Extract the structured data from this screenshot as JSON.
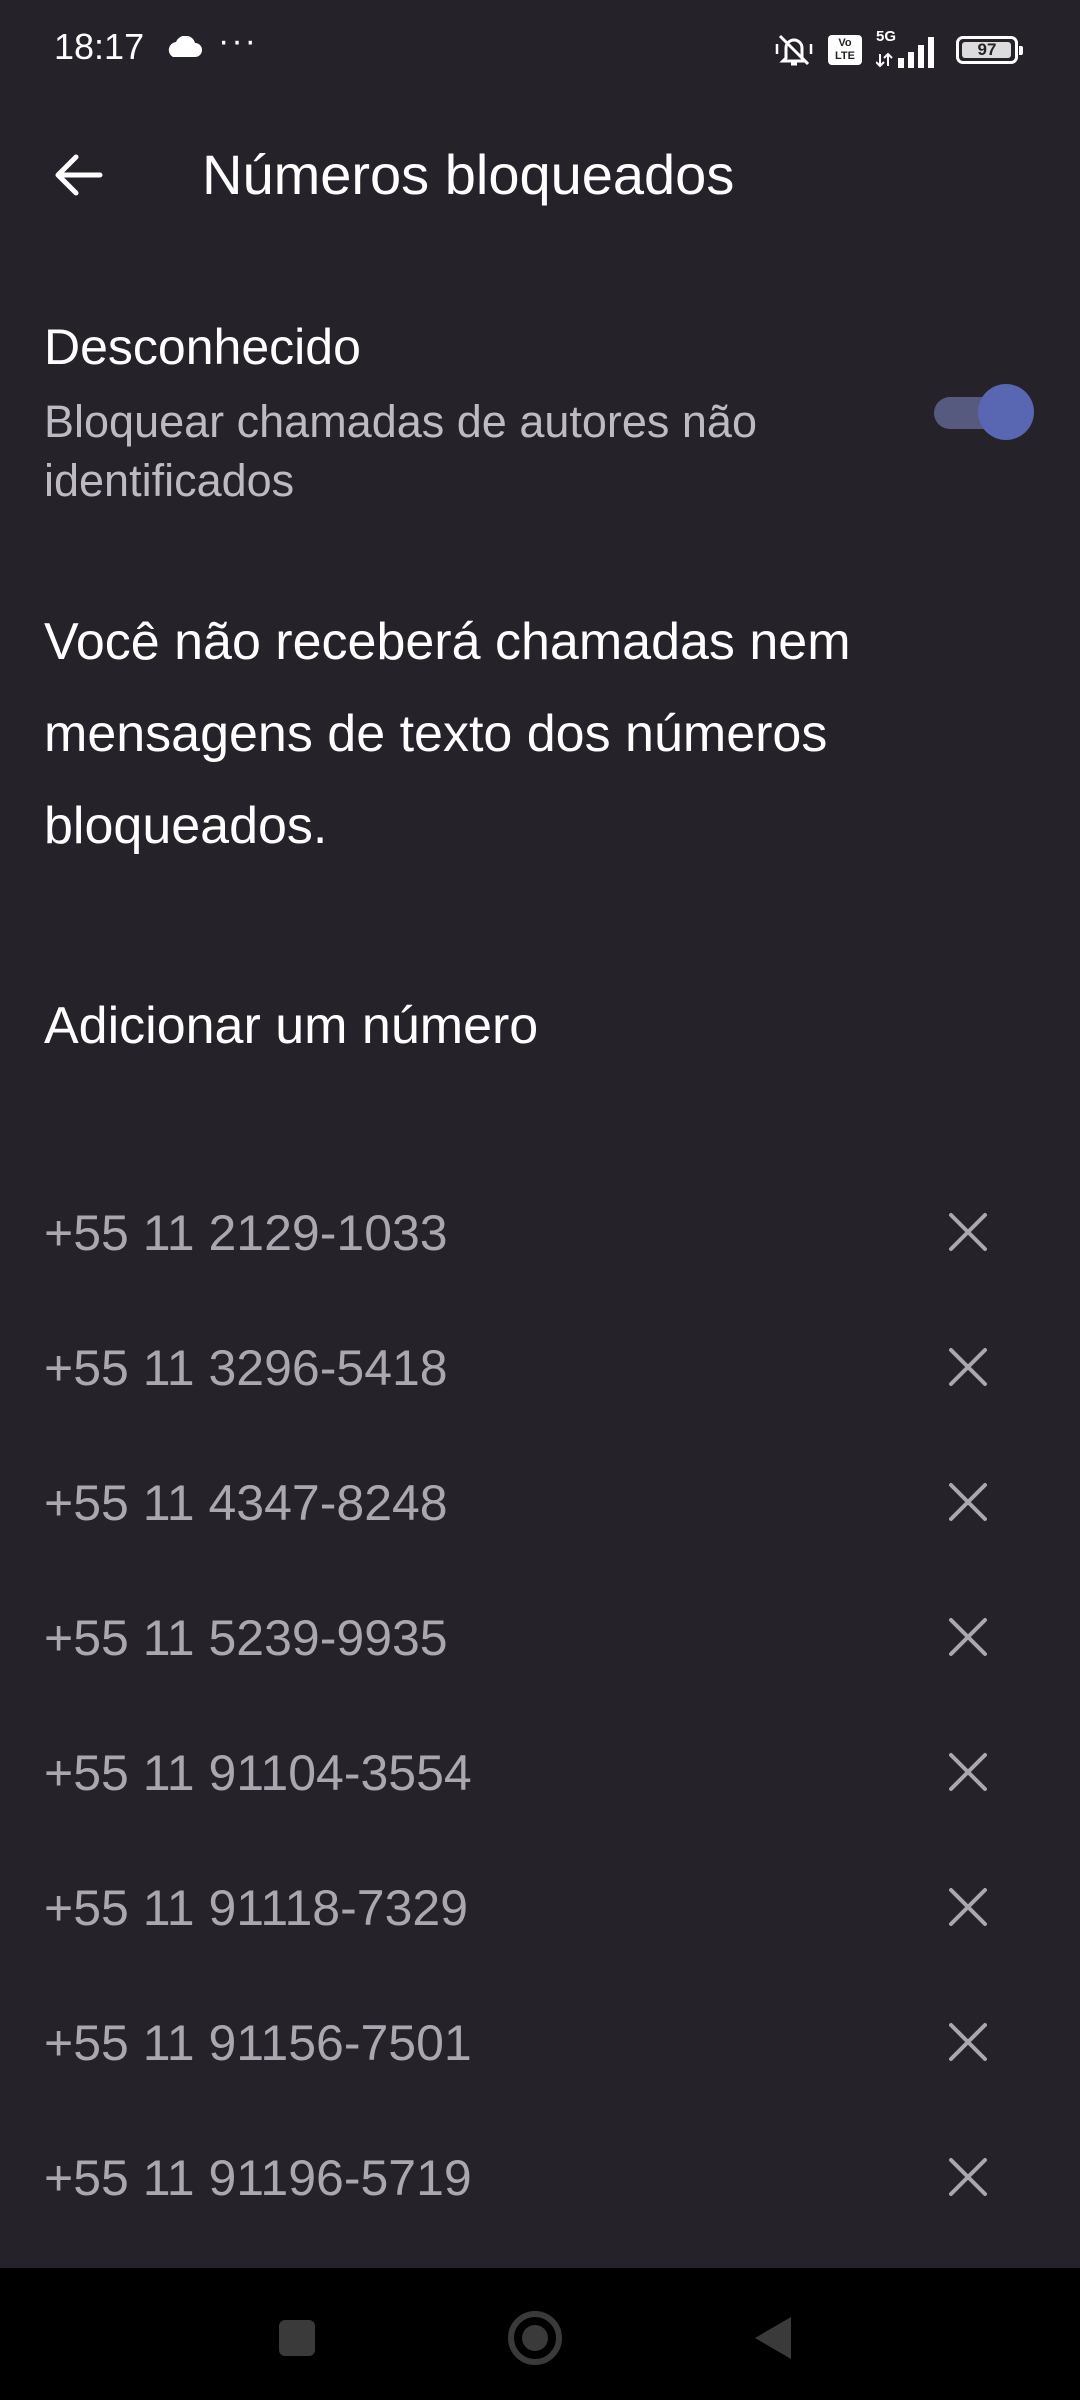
{
  "status_bar": {
    "time": "18:17",
    "more_indicator": "···",
    "volte_label": "Vo LTE",
    "network_label": "5G",
    "battery_level": "97",
    "icons": [
      "cloud-icon",
      "vibrate-icon",
      "volte-icon",
      "signal-5g-icon",
      "battery-icon"
    ]
  },
  "app_bar": {
    "back_icon": "arrow-left-icon",
    "title": "Números bloqueados"
  },
  "unknown_setting": {
    "title": "Desconhecido",
    "description": "Bloquear chamadas de autores não identificados",
    "enabled": true
  },
  "info_text": "Você não receberá chamadas nem mensagens de texto dos números bloqueados.",
  "add_number_label": "Adicionar um número",
  "blocked_numbers": [
    "+55 11 2129-1033",
    "+55 11 3296-5418",
    "+55 11 4347-8248",
    "+55 11 5239-9935",
    "+55 11 91104-3554",
    "+55 11 91118-7329",
    "+55 11 91156-7501",
    "+55 11 91196-5719"
  ],
  "remove_icon": "close-icon",
  "nav_bar": {
    "icons": [
      "recents-icon",
      "home-icon",
      "back-icon"
    ]
  },
  "colors": {
    "background": "#252329",
    "secondary_text": "#bdbac2",
    "number_text": "#aaa7af",
    "toggle_thumb": "#5967b2",
    "toggle_track": "#555a7e",
    "nav_background": "#000000"
  }
}
